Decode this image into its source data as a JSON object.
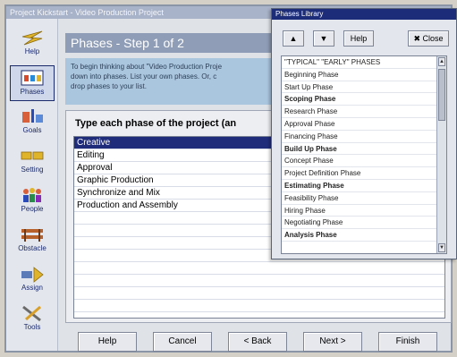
{
  "window": {
    "title": "Project Kickstart - Video Production Project"
  },
  "sidebar": {
    "items": [
      {
        "label": "Help"
      },
      {
        "label": "Phases"
      },
      {
        "label": "Goals"
      },
      {
        "label": "Setting"
      },
      {
        "label": "People"
      },
      {
        "label": "Obstacle"
      },
      {
        "label": "Assign"
      },
      {
        "label": "Tools"
      }
    ]
  },
  "main": {
    "step_title": "Phases - Step 1 of 2",
    "instructions": [
      "To begin thinking about \"Video Production Proje",
      "down into phases.  List your own phases.  Or, c",
      "drop phases to your list."
    ],
    "list_heading": "Type each phase of the project (an",
    "phases": [
      "Creative",
      "Editing",
      "Approval",
      "Graphic Production",
      "Synchronize and Mix",
      "Production and Assembly",
      "",
      "",
      "",
      "",
      "",
      "",
      "",
      ""
    ],
    "buttons": {
      "help": "Help",
      "cancel": "Cancel",
      "back": "< Back",
      "next": "Next >",
      "finish": "Finish"
    }
  },
  "library": {
    "title": "Phases Library",
    "buttons": {
      "up": "▲",
      "down": "▼",
      "help": "Help",
      "close": "✖ Close"
    },
    "items": [
      "\"TYPICAL\" \"EARLY\" PHASES",
      "Beginning Phase",
      "Start Up Phase",
      "Scoping Phase",
      "Research Phase",
      "Approval Phase",
      "Financing Phase",
      "Build Up Phase",
      "Concept Phase",
      "Project Definition Phase",
      "Estimating Phase",
      "Feasibility Phase",
      "Hiring Phase",
      "Negotiating Phase",
      "Analysis Phase"
    ]
  }
}
